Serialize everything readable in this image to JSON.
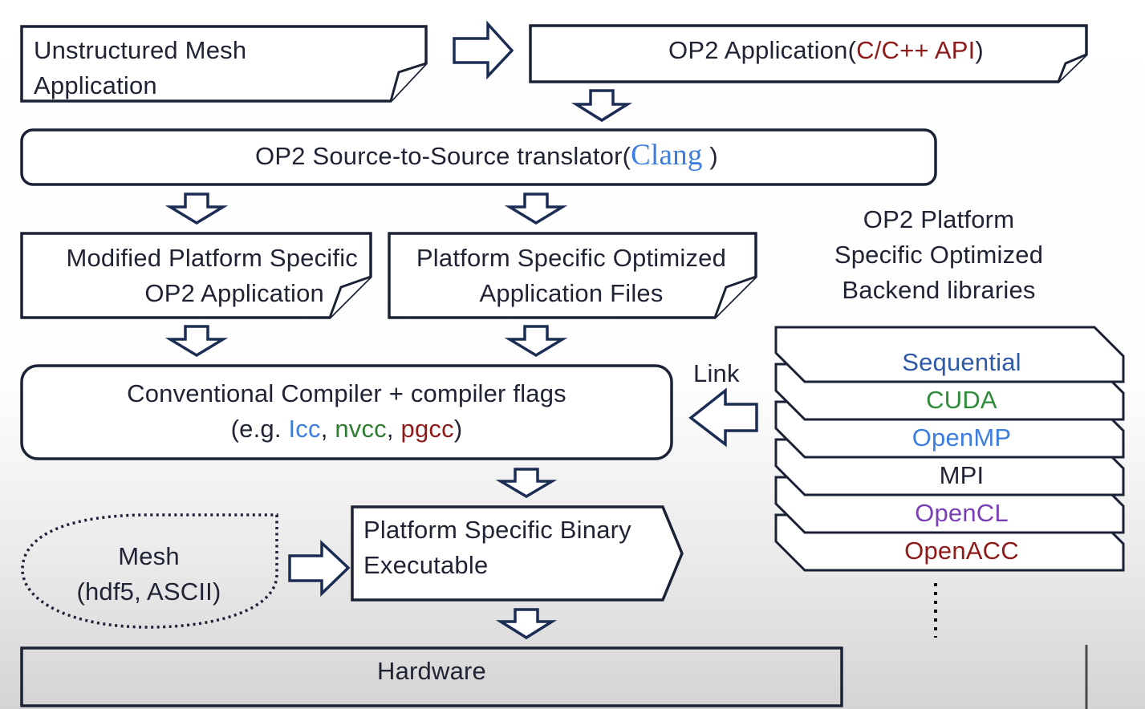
{
  "colors": {
    "stroke": "#1b2236",
    "arrow": "#1c2d55",
    "text": "#1f2333",
    "red": "#8e1a1a",
    "blue": "#3c7de0",
    "green": "#2e7d32",
    "purple": "#7b3fb5",
    "dark_blue": "#2f5aa8"
  },
  "nodes": {
    "unstructured_mesh_app": {
      "line1": "Unstructured Mesh",
      "line2": "Application"
    },
    "op2_application": {
      "text": "OP2 Application",
      "open": "(",
      "api": "C/C++ API",
      "close": ")"
    },
    "translator": {
      "text": "OP2 Source-to-Source translator",
      "open": "(",
      "tool": "Clang",
      "close": " )"
    },
    "modified_app": {
      "line1": "Modified Platform Specific",
      "line2": "OP2  Application"
    },
    "optimized_files": {
      "line1": "Platform Specific Optimized",
      "line2": "Application Files"
    },
    "compiler": {
      "line1": "Conventional Compiler + compiler flags",
      "prefix": "(e.g. ",
      "c1": "Icc",
      "sep1": ", ",
      "c2": "nvcc",
      "sep2": ", ",
      "c3": "pgcc",
      "suffix": ")"
    },
    "mesh": {
      "line1": "Mesh",
      "line2": "(hdf5, ASCII)"
    },
    "binary": {
      "line1": "Platform Specific Binary",
      "line2": "Executable"
    },
    "hardware": {
      "text": "Hardware"
    }
  },
  "backend": {
    "title_line1": "OP2 Platform",
    "title_line2": "Specific Optimized",
    "title_line3": "Backend libraries",
    "link_label": "Link",
    "layers": [
      {
        "name": "Sequential",
        "color": "#2f5aa8"
      },
      {
        "name": "CUDA",
        "color": "#2e8b3a"
      },
      {
        "name": "OpenMP",
        "color": "#3c7de0"
      },
      {
        "name": "MPI",
        "color": "#1f2333"
      },
      {
        "name": "OpenCL",
        "color": "#7b3fb5"
      },
      {
        "name": "OpenACC",
        "color": "#8e1a1a"
      }
    ]
  }
}
